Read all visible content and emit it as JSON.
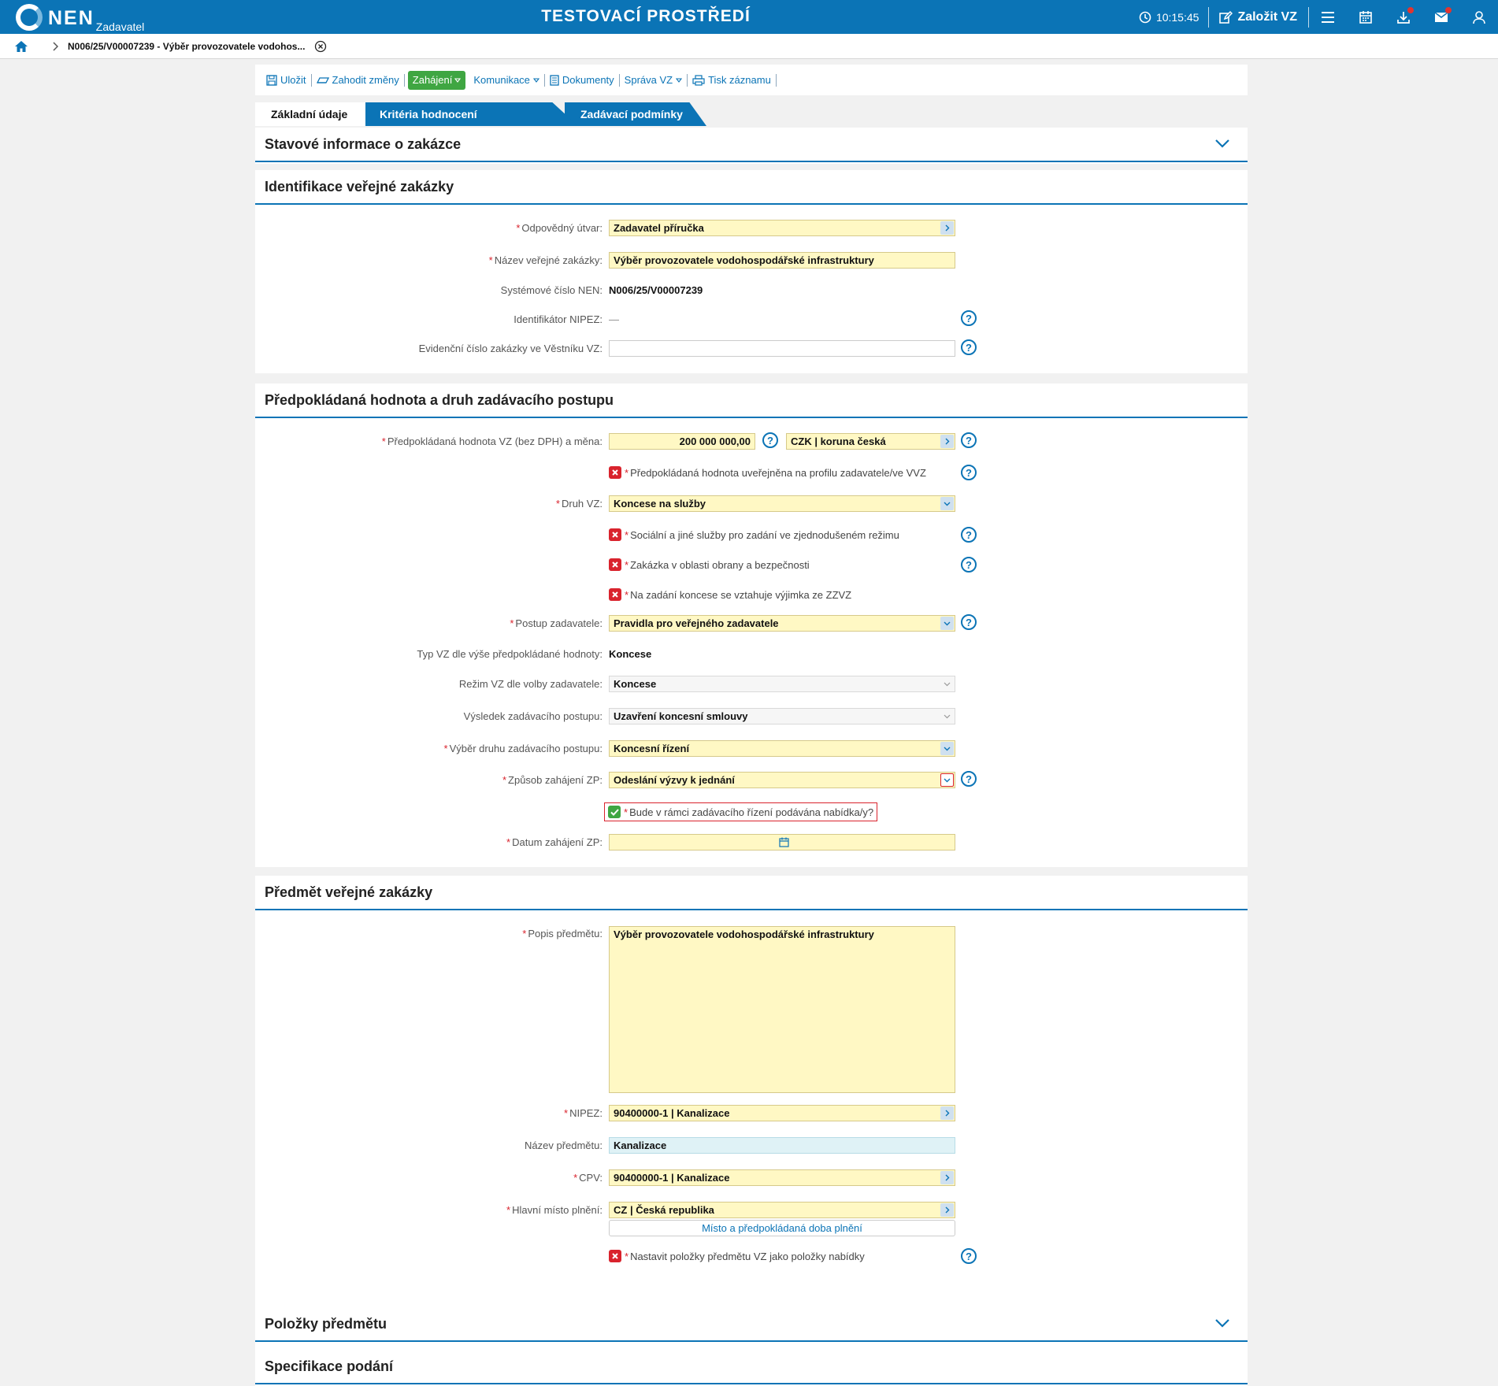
{
  "header": {
    "logo": "NEN",
    "logo_sub": "Zadavatel",
    "env_title": "TESTOVACÍ PROSTŘEDÍ",
    "clock": "10:15:45",
    "create_label": "Založit VZ"
  },
  "breadcrumb": {
    "title": "N006/25/V00007239 - Výběr provozovatele vodohos..."
  },
  "toolbar": {
    "save": "Uložit",
    "discard": "Zahodit změny",
    "start": "Zahájení",
    "communication": "Komunikace",
    "documents": "Dokumenty",
    "manage": "Správa VZ",
    "print": "Tisk záznamu"
  },
  "tabs": [
    "Základní údaje",
    "Kritéria hodnocení",
    "Zadávací podmínky"
  ],
  "sections": {
    "status": "Stavové informace o zakázce",
    "identification": {
      "title": "Identifikace veřejné zakázky",
      "unit_label": "Odpovědný útvar:",
      "unit_value": "Zadavatel příručka",
      "name_label": "Název veřejné zakázky:",
      "name_value": "Výběr provozovatele vodohospodářské infrastruktury",
      "sysnum_label": "Systémové číslo NEN:",
      "sysnum_value": "N006/25/V00007239",
      "nipez_label": "Identifikátor NIPEZ:",
      "nipez_value": "—",
      "journal_label": "Evidenční číslo zakázky ve Věstníku VZ:",
      "journal_value": ""
    },
    "value": {
      "title": "Předpokládaná hodnota a druh zadávacího postupu",
      "amount_label": "Předpokládaná hodnota VZ (bez DPH) a měna:",
      "amount_value": "200 000 000,00",
      "currency_value": "CZK | koruna česká",
      "published_chk": "Předpokládaná hodnota uveřejněna na profilu zadavatele/ve VVZ",
      "kind_label": "Druh VZ:",
      "kind_value": "Koncese na služby",
      "social_chk": "Sociální a jiné služby pro zadání ve zjednodušeném režimu",
      "defense_chk": "Zakázka v oblasti obrany a bezpečnosti",
      "exception_chk": "Na zadání koncese se vztahuje výjimka ze ZZVZ",
      "procedure_label": "Postup zadavatele:",
      "procedure_value": "Pravidla pro veřejného zadavatele",
      "type_label": "Typ VZ dle výše předpokládané hodnoty:",
      "type_value": "Koncese",
      "regime_label": "Režim VZ dle volby zadavatele:",
      "regime_value": "Koncese",
      "result_label": "Výsledek zadávacího postupu:",
      "result_value": "Uzavření koncesní smlouvy",
      "choice_label": "Výběr druhu zadávacího postupu:",
      "choice_value": "Koncesní řízení",
      "method_label": "Způsob zahájení ZP:",
      "method_value": "Odeslání výzvy k jednání",
      "offers_chk": "Bude v rámci zadávacího řízení podávána nabídka/y?",
      "date_label": "Datum zahájení ZP:",
      "date_value": ""
    },
    "subject": {
      "title": "Předmět veřejné zakázky",
      "desc_label": "Popis předmětu:",
      "desc_value": "Výběr provozovatele vodohospodářské infrastruktury",
      "nipez_label": "NIPEZ:",
      "nipez_value": "90400000-1 | Kanalizace",
      "sname_label": "Název předmětu:",
      "sname_value": "Kanalizace",
      "cpv_label": "CPV:",
      "cpv_value": "90400000-1 | Kanalizace",
      "place_label": "Hlavní místo plnění:",
      "place_value": "CZ | Česká republika",
      "place_button": "Místo a předpokládaná doba plnění",
      "items_chk": "Nastavit položky předmětu VZ jako položky nabídky"
    },
    "items": "Položky předmětu",
    "spec": "Specifikace podání"
  },
  "help_symbol": "?",
  "colors": {
    "brand": "#0b74b6",
    "accent_green": "#3fa642",
    "required": "#d9232d",
    "field_fill": "#fff8c4"
  }
}
